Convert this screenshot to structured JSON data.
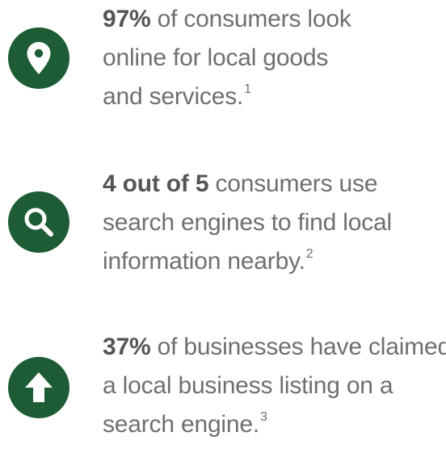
{
  "colors": {
    "icon_background": "#1d5c34",
    "body_text": "#6f6f6f",
    "highlight_text": "#555555"
  },
  "stats": [
    {
      "icon": "map-pin-icon",
      "highlight": "97%",
      "line1_rest": " of consumers look",
      "line2": "online for local goods",
      "line3": "and services.",
      "footnote": "1"
    },
    {
      "icon": "search-icon",
      "highlight": "4 out of 5",
      "line1_rest": " consumers use",
      "line2": "search engines to find local",
      "line3": "information nearby.",
      "footnote": "2"
    },
    {
      "icon": "arrow-up-icon",
      "highlight": "37%",
      "line1_rest": " of businesses have claimed",
      "line2": "a local business listing on a",
      "line3": "search engine.",
      "footnote": "3"
    }
  ]
}
